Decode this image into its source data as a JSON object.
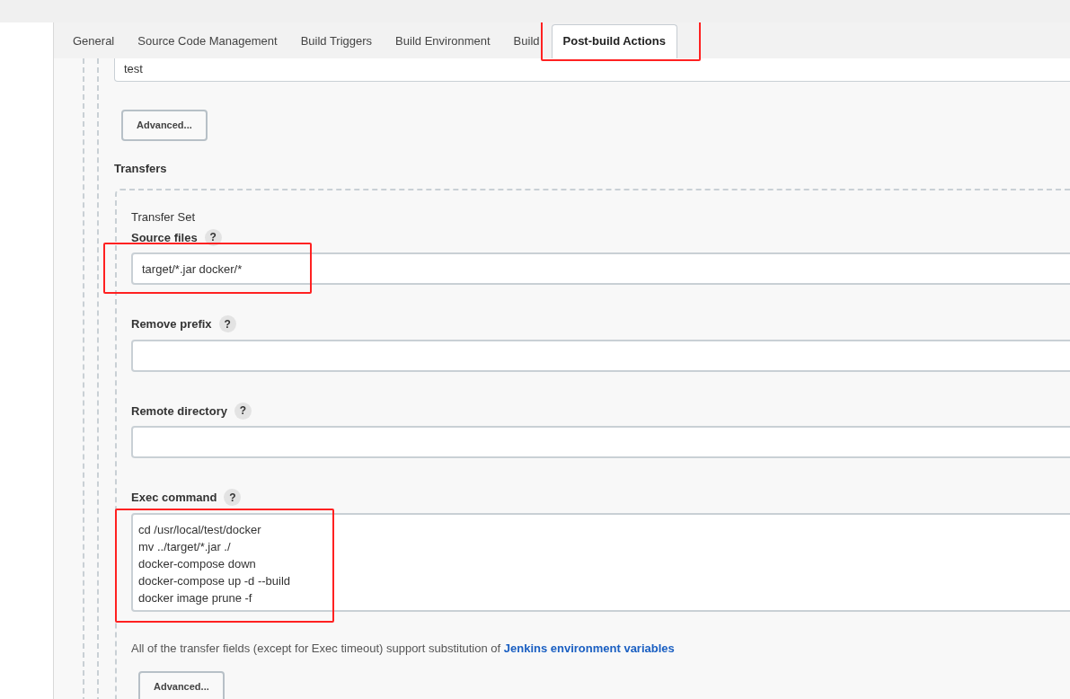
{
  "tabs": [
    {
      "label": "General",
      "selected": false,
      "highlighted": false
    },
    {
      "label": "Source Code Management",
      "selected": false,
      "highlighted": false
    },
    {
      "label": "Build Triggers",
      "selected": false,
      "highlighted": false
    },
    {
      "label": "Build Environment",
      "selected": false,
      "highlighted": false
    },
    {
      "label": "Build",
      "selected": false,
      "highlighted": false
    },
    {
      "label": "Post-build Actions",
      "selected": true,
      "highlighted": true
    }
  ],
  "server_field": {
    "value": "test"
  },
  "advanced_button": "Advanced...",
  "transfers": {
    "title": "Transfers",
    "transfer_set": {
      "title": "Transfer Set",
      "fields": [
        {
          "kind": "input",
          "label": "Source files",
          "help": "?",
          "value": "target/*.jar docker/*",
          "highlighted": true
        },
        {
          "kind": "input",
          "label": "Remove prefix",
          "help": "?",
          "highlighted": false
        },
        {
          "kind": "input",
          "label": "Remote directory",
          "help": "?",
          "highlighted": false
        },
        {
          "kind": "textarea",
          "label": "Exec command",
          "help": "?",
          "value": "cd /usr/local/test/docker\nmv ../target/*.jar ./\ndocker-compose down\ndocker-compose up -d --build\ndocker image prune -f",
          "highlighted": true
        }
      ],
      "note": "All of the transfer fields (except for Exec timeout) support substitution of ",
      "note_link": "Jenkins environment variables",
      "advanced_button": "Advanced..."
    }
  }
}
